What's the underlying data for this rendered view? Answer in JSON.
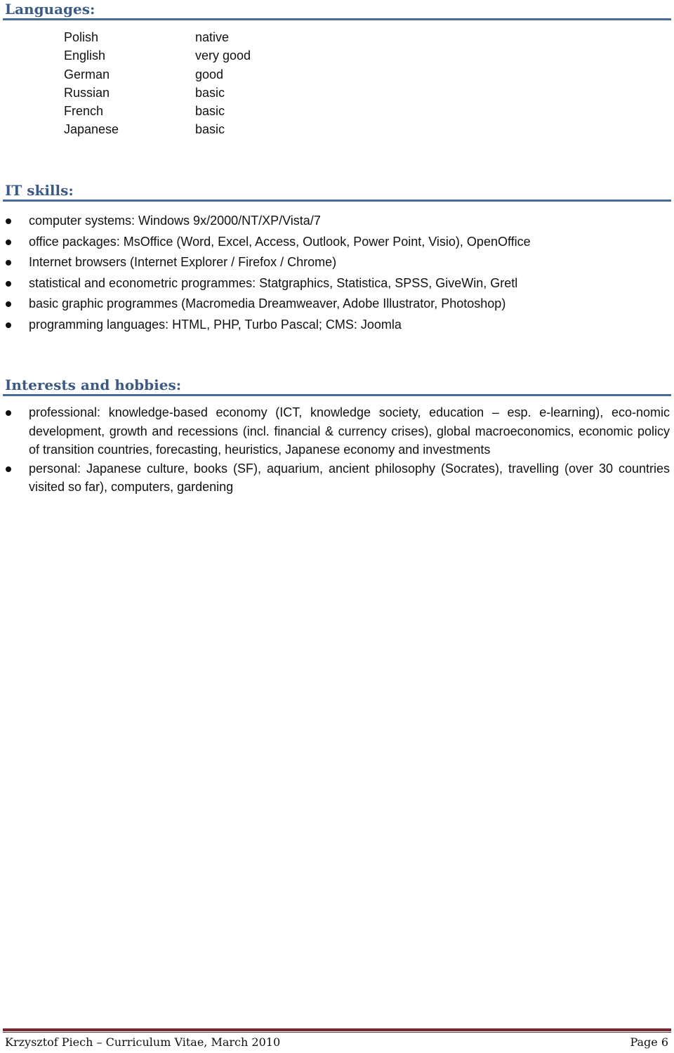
{
  "sections": {
    "languages": {
      "title": "Languages:",
      "items": [
        {
          "language": "Polish",
          "level": "native"
        },
        {
          "language": "English",
          "level": "very good"
        },
        {
          "language": "German",
          "level": "good"
        },
        {
          "language": "Russian",
          "level": "basic"
        },
        {
          "language": "French",
          "level": "basic"
        },
        {
          "language": "Japanese",
          "level": "basic"
        }
      ]
    },
    "it_skills": {
      "title": "IT skills:",
      "items": [
        "computer systems: Windows 9x/2000/NT/XP/Vista/7",
        "office packages: MsOffice (Word, Excel, Access, Outlook, Power Point, Visio), OpenOffice",
        "Internet browsers (Internet Explorer / Firefox / Chrome)",
        "statistical and econometric programmes: Statgraphics, Statistica, SPSS, GiveWin, Gretl",
        "basic graphic programmes (Macromedia Dreamweaver, Adobe Illustrator, Photoshop)",
        "programming languages: HTML, PHP, Turbo Pascal; CMS: Joomla"
      ]
    },
    "interests": {
      "title": "Interests and hobbies:",
      "items": [
        "professional: knowledge-based economy (ICT, knowledge society, education – esp. e-learning), eco-nomic development, growth and recessions (incl. financial & currency crises), global macroeconomics, economic policy of transition countries, forecasting, heuristics, Japanese economy and investments",
        "personal: Japanese culture, books (SF), aquarium, ancient philosophy (Socrates), travelling (over 30 countries visited so far), computers, gardening"
      ]
    }
  },
  "footer": {
    "left": "Krzysztof Piech – Curriculum Vitae, March 2010",
    "right": "Page 6"
  },
  "colors": {
    "heading": "#3b5a86",
    "heading_rule": "#4a6a98",
    "footer_rule": "#6e2a2e"
  }
}
